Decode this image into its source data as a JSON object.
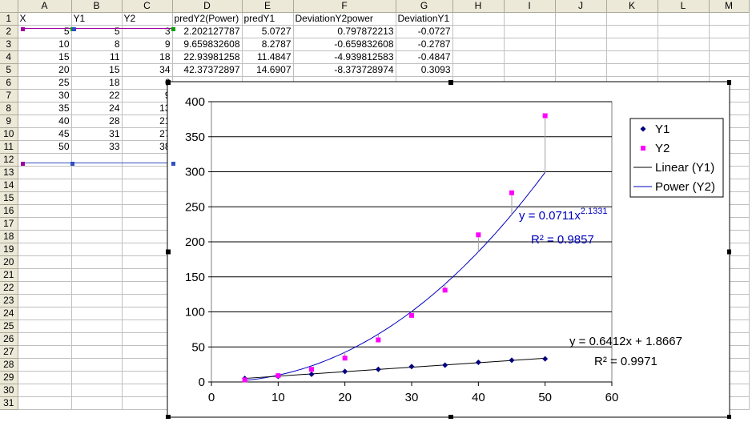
{
  "sheet": {
    "column_headers": [
      "A",
      "B",
      "C",
      "D",
      "E",
      "F",
      "G",
      "H",
      "I",
      "J",
      "K",
      "L",
      "M"
    ],
    "row_numbers": [
      "1",
      "2",
      "3",
      "4",
      "5",
      "6",
      "7",
      "8",
      "9",
      "10",
      "11",
      "12",
      "13",
      "14",
      "15",
      "16",
      "17",
      "18",
      "19",
      "20",
      "21",
      "22",
      "23",
      "24",
      "25",
      "26",
      "27",
      "28",
      "29",
      "30",
      "31"
    ],
    "rows": [
      [
        "X",
        "Y1",
        "Y2",
        "predY2(Power)",
        "predY1",
        "DeviationY2power",
        "DeviationY1",
        "",
        "",
        "",
        "",
        "",
        ""
      ],
      [
        "5",
        "5",
        "3",
        "2.202127787",
        "5.0727",
        "0.797872213",
        "-0.0727",
        "",
        "",
        "",
        "",
        "",
        ""
      ],
      [
        "10",
        "8",
        "9",
        "9.659832608",
        "8.2787",
        "-0.659832608",
        "-0.2787",
        "",
        "",
        "",
        "",
        "",
        ""
      ],
      [
        "15",
        "11",
        "18",
        "22.93981258",
        "11.4847",
        "-4.939812583",
        "-0.4847",
        "",
        "",
        "",
        "",
        "",
        ""
      ],
      [
        "20",
        "15",
        "34",
        "42.37372897",
        "14.6907",
        "-8.373728974",
        "0.3093",
        "",
        "",
        "",
        "",
        "",
        ""
      ],
      [
        "25",
        "18",
        "6",
        "",
        "",
        "",
        "",
        "",
        "",
        "",
        "",
        "",
        ""
      ],
      [
        "30",
        "22",
        "9",
        "",
        "",
        "",
        "",
        "",
        "",
        "",
        "",
        "",
        ""
      ],
      [
        "35",
        "24",
        "13",
        "",
        "",
        "",
        "",
        "",
        "",
        "",
        "",
        "",
        ""
      ],
      [
        "40",
        "28",
        "21",
        "",
        "",
        "",
        "",
        "",
        "",
        "",
        "",
        "",
        ""
      ],
      [
        "45",
        "31",
        "27",
        "",
        "",
        "",
        "",
        "",
        "",
        "",
        "",
        "",
        ""
      ],
      [
        "50",
        "33",
        "38",
        "",
        "",
        "",
        "",
        "",
        "",
        "",
        "",
        "",
        ""
      ]
    ]
  },
  "chart_data": {
    "type": "scatter",
    "x": [
      5,
      10,
      15,
      20,
      25,
      30,
      35,
      40,
      45,
      50
    ],
    "series": [
      {
        "name": "Y1",
        "values": [
          5,
          8,
          11,
          15,
          18,
          22,
          24,
          28,
          31,
          33
        ],
        "color": "#000080",
        "marker": "diamond"
      },
      {
        "name": "Y2",
        "values": [
          3,
          9,
          18,
          34,
          60,
          95,
          131,
          210,
          270,
          380
        ],
        "color": "#ff00ff",
        "marker": "square"
      }
    ],
    "trendlines": [
      {
        "name": "Linear (Y1)",
        "kind": "linear",
        "slope": 0.6412,
        "intercept": 1.8667,
        "color": "#000000",
        "equation": "y = 0.6412x + 1.8667",
        "r2": "R² = 0.9971"
      },
      {
        "name": "Power (Y2)",
        "kind": "power",
        "coef": 0.0711,
        "exponent": 2.1331,
        "color": "#0000c0",
        "equation_base": "y = 0.0711x",
        "equation_exp": "2.1331",
        "r2": "R² = 0.9857"
      }
    ],
    "deviation_lines": true,
    "xlim": [
      0,
      60
    ],
    "ylim": [
      0,
      400
    ],
    "xticks": [
      "0",
      "10",
      "20",
      "30",
      "40",
      "50",
      "60"
    ],
    "yticks": [
      "0",
      "50",
      "100",
      "150",
      "200",
      "250",
      "300",
      "350",
      "400"
    ],
    "grid": "horizontal",
    "legend_position": "right",
    "title": "",
    "xlabel": "",
    "ylabel": ""
  }
}
